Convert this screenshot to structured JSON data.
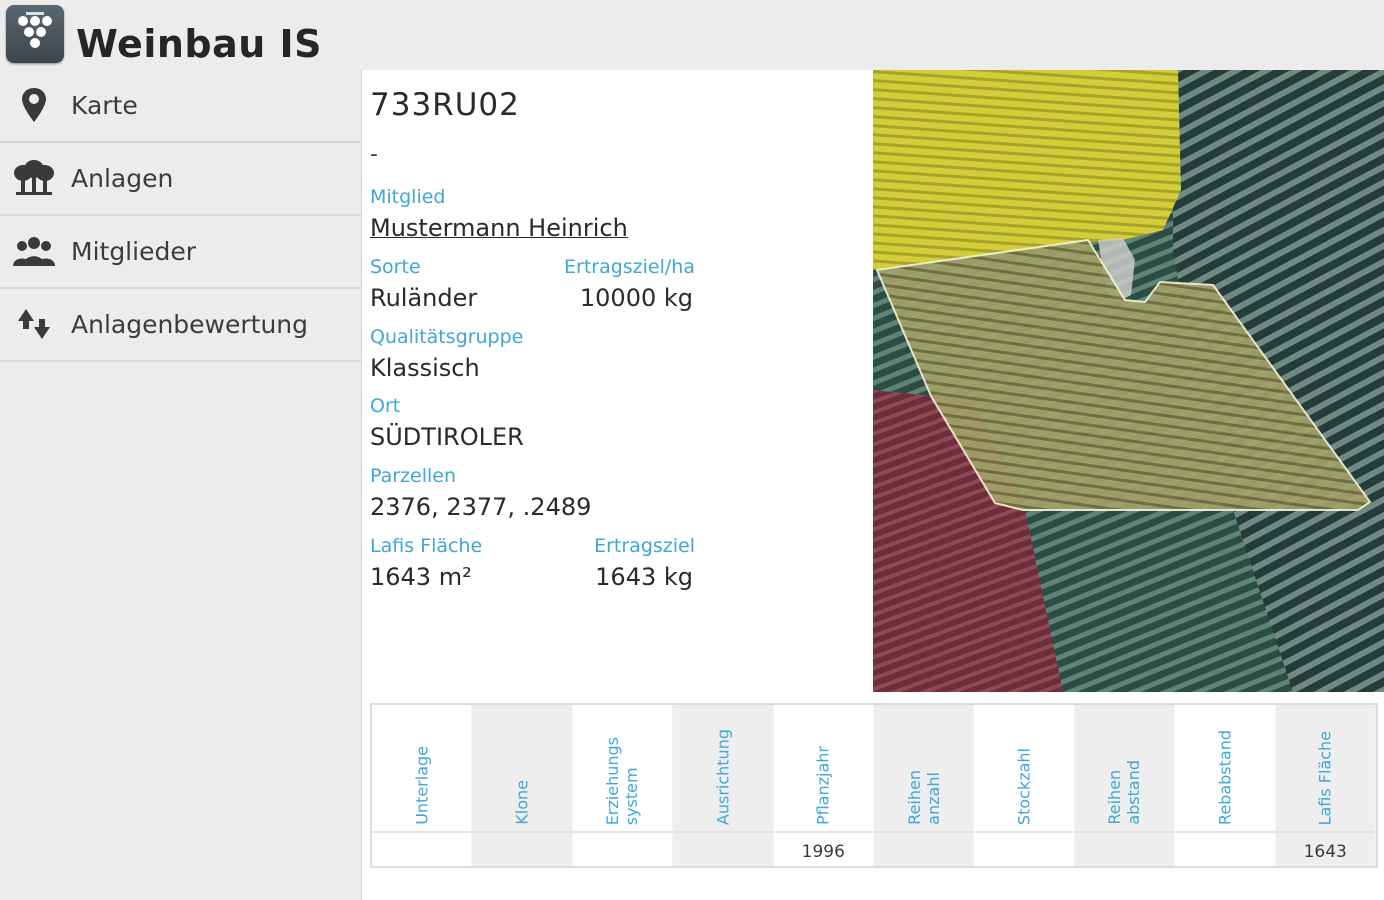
{
  "app": {
    "title": "Weinbau IS"
  },
  "sidebar": {
    "items": [
      {
        "label": "Karte",
        "icon": "map-pin-icon"
      },
      {
        "label": "Anlagen",
        "icon": "vineyards-icon"
      },
      {
        "label": "Mitglieder",
        "icon": "members-icon"
      },
      {
        "label": "Anlagenbewertung",
        "icon": "rating-arrows-icon"
      }
    ]
  },
  "detail": {
    "id": "733RU02",
    "subtitle": "-",
    "mitglied_label": "Mitglied",
    "mitglied_value": "Mustermann Heinrich",
    "sorte_label": "Sorte",
    "sorte_value": "Ruländer",
    "ertragsziel_ha_label": "Ertragsziel/ha",
    "ertragsziel_ha_value": "10000 kg",
    "qualitaetsgruppe_label": "Qualitätsgruppe",
    "qualitaetsgruppe_value": "Klassisch",
    "ort_label": "Ort",
    "ort_value": "SÜDTIROLER",
    "parzellen_label": "Parzellen",
    "parzellen_value": "2376, 2377, .2489",
    "lafis_label": "Lafis Fläche",
    "lafis_value": "1643 m²",
    "ertragsziel_label": "Ertragsziel",
    "ertragsziel_value": "1643 kg"
  },
  "colors": {
    "accent": "#3fa6d6",
    "header_bg": "#ececec",
    "field_highlight": "#b5b35a",
    "field_yellow": "#d8d23a",
    "field_red": "#6b2f3a"
  },
  "table": {
    "columns": [
      {
        "header": "Unterlage",
        "value": ""
      },
      {
        "header": "Klone",
        "value": ""
      },
      {
        "header": "Erziehungs\nsystem",
        "value": ""
      },
      {
        "header": "Ausrichtung",
        "value": ""
      },
      {
        "header": "Pflanzjahr",
        "value": "1996"
      },
      {
        "header": "Reihen\nanzahl",
        "value": ""
      },
      {
        "header": "Stockzahl",
        "value": ""
      },
      {
        "header": "Reihen\nabstand",
        "value": ""
      },
      {
        "header": "Rebabstand",
        "value": ""
      },
      {
        "header": "Lafis Fläche",
        "value": "1643"
      }
    ]
  }
}
